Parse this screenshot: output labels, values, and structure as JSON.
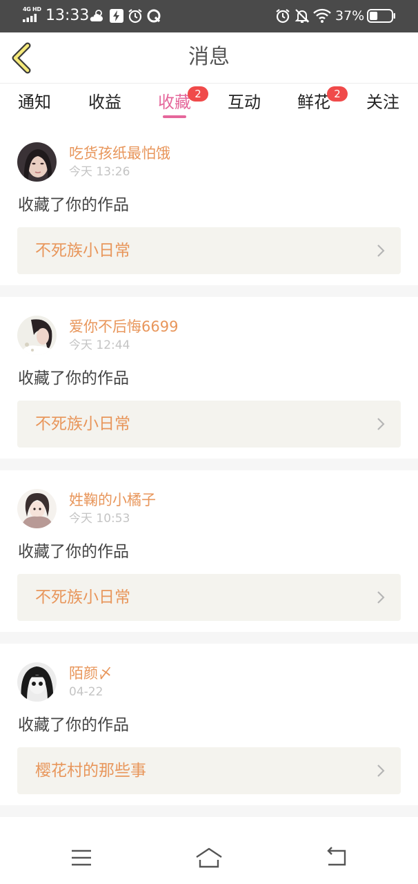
{
  "status_bar": {
    "network": "4G HD",
    "time": "13:33",
    "battery_percent": "37%",
    "battery_level": 0.37,
    "left_icons": [
      "cloud-sun-icon",
      "flash-icon",
      "alarm-icon",
      "q-app-icon"
    ],
    "right_icons": [
      "alarm-icon",
      "bell-off-icon",
      "wifi-icon",
      "battery-icon"
    ]
  },
  "header": {
    "title": "消息",
    "back_icon": "chevron-left-icon"
  },
  "tabs": [
    {
      "label": "通知",
      "badge": ""
    },
    {
      "label": "收益",
      "badge": ""
    },
    {
      "label": "收藏",
      "badge": "2",
      "active": true
    },
    {
      "label": "互动",
      "badge": ""
    },
    {
      "label": "鲜花",
      "badge": "2"
    },
    {
      "label": "关注",
      "badge": ""
    }
  ],
  "notifications": [
    {
      "user": "吃货孩纸最怕饿",
      "time": "今天 13:26",
      "action": "收藏了你的作品",
      "work": "不死族小日常"
    },
    {
      "user": "爱你不后悔6699",
      "time": "今天 12:44",
      "action": "收藏了你的作品",
      "work": "不死族小日常"
    },
    {
      "user": "姓鞠的小橘子",
      "time": "今天 10:53",
      "action": "收藏了你的作品",
      "work": "不死族小日常"
    },
    {
      "user": "陌颜〆",
      "time": "04-22",
      "action": "收藏了你的作品",
      "work": "樱花村的那些事"
    }
  ],
  "nav_bar": {
    "buttons": [
      "menu-icon",
      "home-icon",
      "back-icon"
    ]
  },
  "colors": {
    "accent_pink": "#e5679b",
    "username_orange": "#e8965b",
    "badge_red": "#f04a4a",
    "card_bg": "#f4f3ee",
    "status_bar_bg": "#4a4a4a"
  }
}
